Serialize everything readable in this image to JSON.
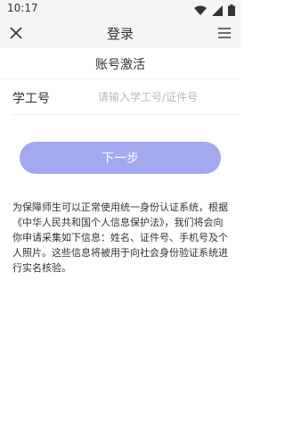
{
  "status_bar": {
    "time": "10:17"
  },
  "header": {
    "title": "登录"
  },
  "page": {
    "section_title": "账号激活"
  },
  "form": {
    "id_label": "学工号",
    "id_placeholder": "请输入学工号/证件号"
  },
  "actions": {
    "next_label": "下一步"
  },
  "notice": {
    "text": "为保障师生可以正常使用统一身份认证系统，根据《中华人民共和国个人信息保护法》，我们将会向你申请采集如下信息：姓名、证件号、手机号及个人照片。这些信息将被用于向社会身份验证系统进行实名核验。"
  },
  "colors": {
    "button_bg": "#a3a9ef",
    "header_bg": "#f5f5f5"
  },
  "icons": {
    "close": "close-icon",
    "menu": "menu-icon",
    "wifi": "wifi-icon",
    "signal": "signal-icon",
    "battery": "battery-icon"
  }
}
